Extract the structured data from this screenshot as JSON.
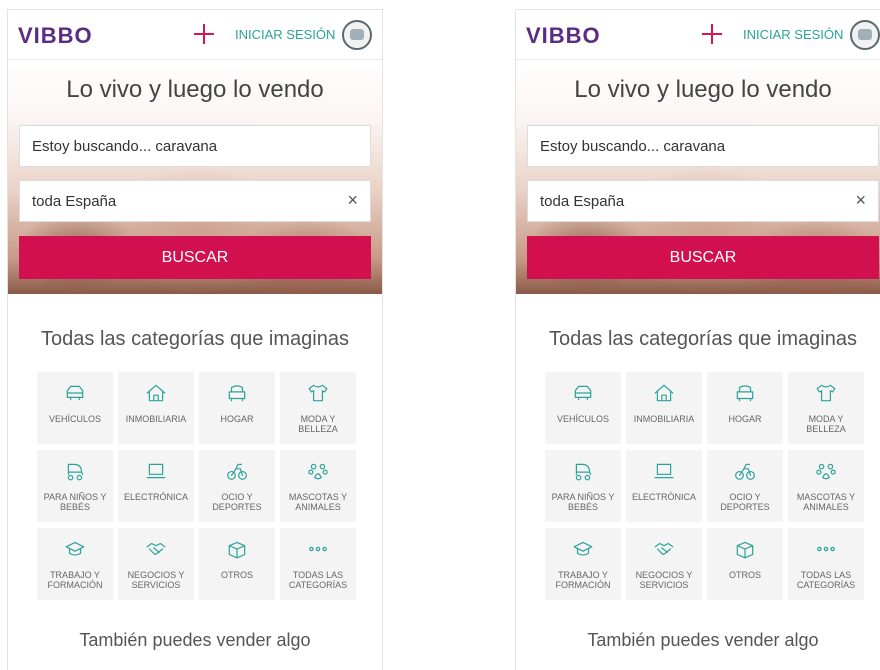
{
  "screens": [
    {
      "header": {
        "logo_text": "VIBBO",
        "login_label": "INICIAR SESIÓN"
      },
      "hero": {
        "title": "Lo vivo y luego lo vendo",
        "search_value": "Estoy buscando... caravana",
        "location_value": "toda España",
        "clear_label": "×",
        "button_label": "BUSCAR"
      },
      "categories": {
        "title": "Todas las categorías que imaginas",
        "items": [
          {
            "label": "VEHÍCULOS",
            "icon": "car-icon"
          },
          {
            "label": "INMOBILIARIA",
            "icon": "house-icon"
          },
          {
            "label": "HOGAR",
            "icon": "armchair-icon"
          },
          {
            "label": "MODA Y BELLEZA",
            "icon": "tshirt-icon"
          },
          {
            "label": "PARA NIÑOS Y BEBÉS",
            "icon": "stroller-icon"
          },
          {
            "label": "ELECTRÓNICA",
            "icon": "laptop-icon"
          },
          {
            "label": "OCIO Y DEPORTES",
            "icon": "bicycle-icon"
          },
          {
            "label": "MASCOTAS Y ANIMALES",
            "icon": "paw-icon"
          },
          {
            "label": "TRABAJO Y FORMACIÓN",
            "icon": "graduation-cap-icon"
          },
          {
            "label": "NEGOCIOS Y SERVICIOS",
            "icon": "handshake-icon"
          },
          {
            "label": "OTROS",
            "icon": "box-icon"
          },
          {
            "label": "TODAS LAS CATEGORÍAS",
            "icon": "more-dots-icon"
          }
        ]
      },
      "sell": {
        "title": "También puedes vender algo"
      }
    },
    {
      "header": {
        "logo_text": "VIBBO",
        "login_label": "INICIAR SESIÓN"
      },
      "hero": {
        "title": "Lo vivo y luego lo vendo",
        "search_value": "Estoy buscando... caravana",
        "location_value": "toda España",
        "clear_label": "×",
        "button_label": "BUSCAR"
      },
      "categories": {
        "title": "Todas las categorías que imaginas",
        "items": [
          {
            "label": "VEHÍCULOS",
            "icon": "car-icon"
          },
          {
            "label": "INMOBILIARIA",
            "icon": "house-icon"
          },
          {
            "label": "HOGAR",
            "icon": "armchair-icon"
          },
          {
            "label": "MODA Y BELLEZA",
            "icon": "tshirt-icon"
          },
          {
            "label": "PARA NIÑOS Y BEBÉS",
            "icon": "stroller-icon"
          },
          {
            "label": "ELECTRÓNICA",
            "icon": "laptop-icon"
          },
          {
            "label": "OCIO Y DEPORTES",
            "icon": "bicycle-icon"
          },
          {
            "label": "MASCOTAS Y ANIMALES",
            "icon": "paw-icon"
          },
          {
            "label": "TRABAJO Y FORMACIÓN",
            "icon": "graduation-cap-icon"
          },
          {
            "label": "NEGOCIOS Y SERVICIOS",
            "icon": "handshake-icon"
          },
          {
            "label": "OTROS",
            "icon": "box-icon"
          },
          {
            "label": "TODAS LAS CATEGORÍAS",
            "icon": "more-dots-icon"
          }
        ]
      },
      "sell": {
        "title": "También puedes vender algo"
      }
    }
  ],
  "colors": {
    "brand_pink": "#d3104f",
    "accent_teal": "#2aa39a",
    "logo_purple": "#5b2c83"
  }
}
